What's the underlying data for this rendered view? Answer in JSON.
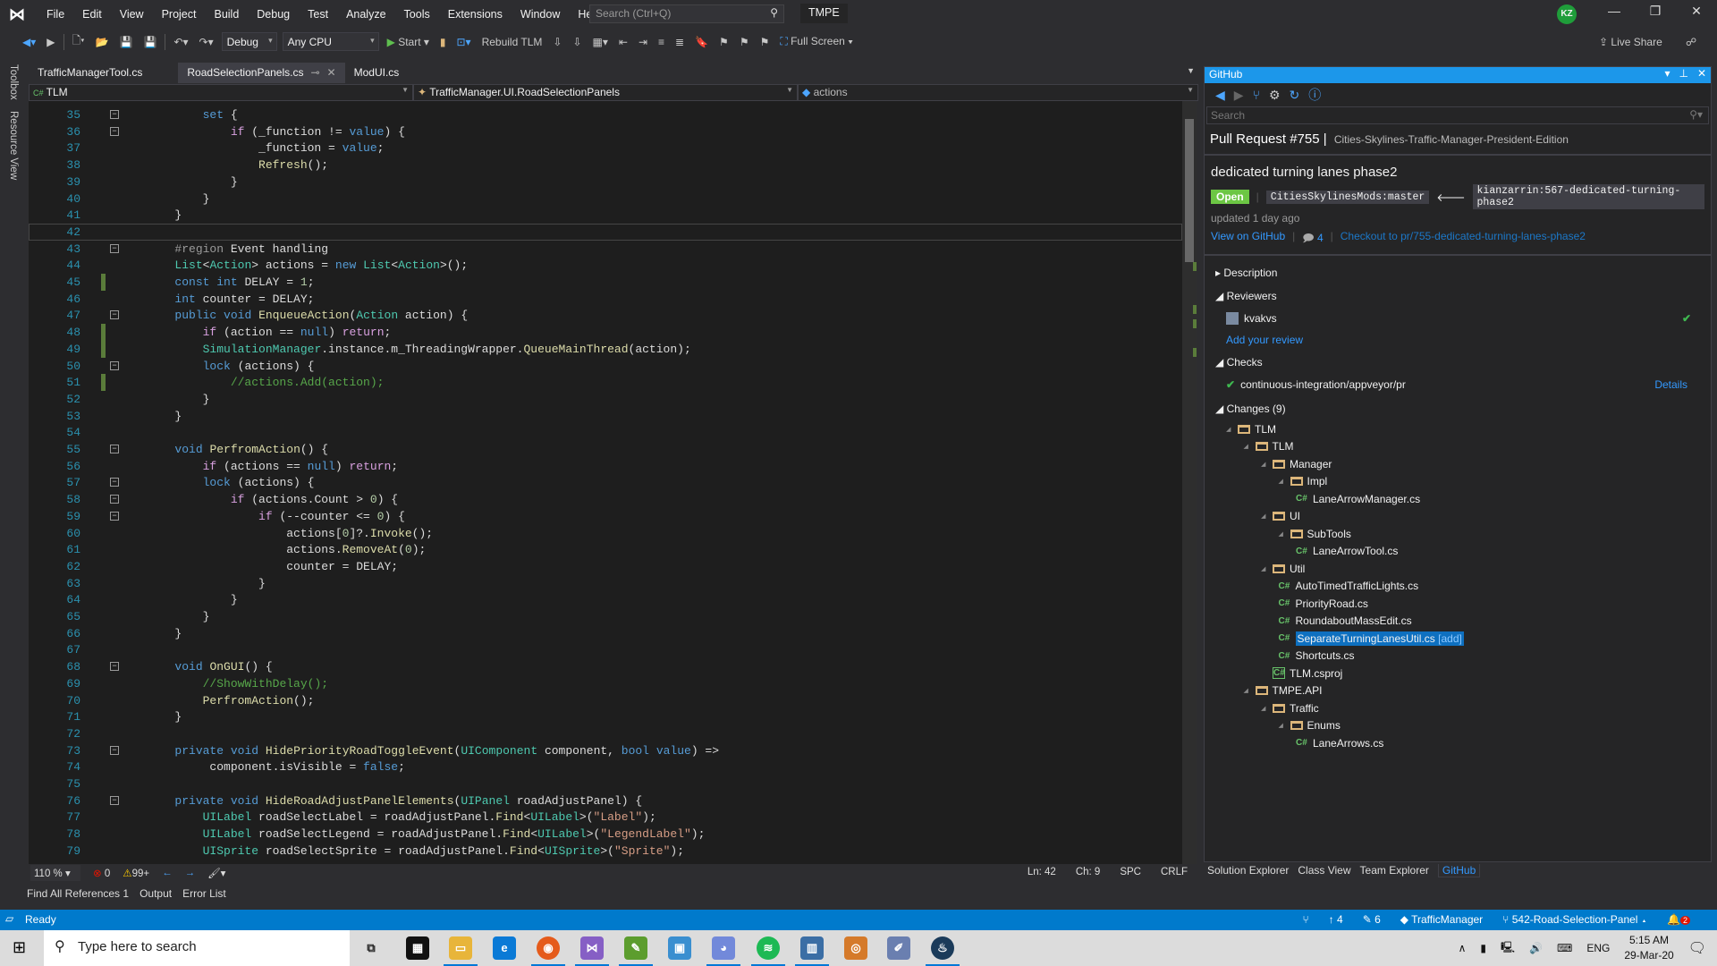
{
  "menubar": {
    "items": [
      "File",
      "Edit",
      "View",
      "Project",
      "Build",
      "Debug",
      "Test",
      "Analyze",
      "Tools",
      "Extensions",
      "Window",
      "Help"
    ],
    "search_placeholder": "Search (Ctrl+Q)",
    "solution": "TMPE",
    "user_initials": "KZ"
  },
  "toolbar": {
    "config": "Debug",
    "platform": "Any CPU",
    "start": "Start",
    "rebuild": "Rebuild TLM",
    "fullscreen": "Full Screen",
    "liveshare": "Live Share"
  },
  "left_strip": {
    "toolbox": "Toolbox",
    "resource_view": "Resource View"
  },
  "doc_tabs": [
    {
      "label": "TrafficManagerTool.cs",
      "active": false
    },
    {
      "label": "RoadSelectionPanels.cs",
      "active": true
    },
    {
      "label": "ModUI.cs",
      "active": false
    }
  ],
  "navbar": {
    "project": "TLM",
    "class": "TrafficManager.UI.RoadSelectionPanels",
    "member": "actions"
  },
  "editor": {
    "current_line": 42,
    "lines": [
      {
        "n": 35,
        "f": 1,
        "t": [
          [
            "p",
            "            "
          ],
          [
            "k",
            "set"
          ],
          [
            "p",
            " {"
          ]
        ]
      },
      {
        "n": 36,
        "f": 1,
        "t": [
          [
            "p",
            "                "
          ],
          [
            "c",
            "if"
          ],
          [
            "p",
            " (_function != "
          ],
          [
            "k",
            "value"
          ],
          [
            "p",
            ") {"
          ]
        ]
      },
      {
        "n": 37,
        "t": [
          [
            "p",
            "                    _function = "
          ],
          [
            "k",
            "value"
          ],
          [
            "p",
            ";"
          ]
        ]
      },
      {
        "n": 38,
        "t": [
          [
            "p",
            "                    "
          ],
          [
            "m",
            "Refresh"
          ],
          [
            "p",
            "();"
          ]
        ]
      },
      {
        "n": 39,
        "t": [
          [
            "p",
            "                }"
          ]
        ]
      },
      {
        "n": 40,
        "t": [
          [
            "p",
            "            }"
          ]
        ]
      },
      {
        "n": 41,
        "t": [
          [
            "p",
            "        }"
          ]
        ]
      },
      {
        "n": 42,
        "t": []
      },
      {
        "n": 43,
        "f": 1,
        "t": [
          [
            "p",
            "        "
          ],
          [
            "r",
            "#region"
          ],
          [
            "p",
            " Event handling"
          ]
        ]
      },
      {
        "n": 44,
        "t": [
          [
            "p",
            "        "
          ],
          [
            "t",
            "List"
          ],
          [
            "p",
            "<"
          ],
          [
            "t",
            "Action"
          ],
          [
            "p",
            "> actions = "
          ],
          [
            "k",
            "new"
          ],
          [
            "p",
            " "
          ],
          [
            "t",
            "List"
          ],
          [
            "p",
            "<"
          ],
          [
            "t",
            "Action"
          ],
          [
            "p",
            ">();"
          ]
        ]
      },
      {
        "n": 45,
        "g": 1,
        "t": [
          [
            "p",
            "        "
          ],
          [
            "k",
            "const"
          ],
          [
            "p",
            " "
          ],
          [
            "k",
            "int"
          ],
          [
            "p",
            " DELAY = "
          ],
          [
            "n",
            "1"
          ],
          [
            "p",
            ";"
          ]
        ]
      },
      {
        "n": 46,
        "t": [
          [
            "p",
            "        "
          ],
          [
            "k",
            "int"
          ],
          [
            "p",
            " counter = DELAY;"
          ]
        ]
      },
      {
        "n": 47,
        "f": 1,
        "t": [
          [
            "p",
            "        "
          ],
          [
            "k",
            "public"
          ],
          [
            "p",
            " "
          ],
          [
            "k",
            "void"
          ],
          [
            "p",
            " "
          ],
          [
            "m",
            "EnqueueAction"
          ],
          [
            "p",
            "("
          ],
          [
            "t",
            "Action"
          ],
          [
            "p",
            " action) {"
          ]
        ]
      },
      {
        "n": 48,
        "g": 1,
        "t": [
          [
            "p",
            "            "
          ],
          [
            "c",
            "if"
          ],
          [
            "p",
            " (action == "
          ],
          [
            "k",
            "null"
          ],
          [
            "p",
            ") "
          ],
          [
            "c",
            "return"
          ],
          [
            "p",
            ";"
          ]
        ]
      },
      {
        "n": 49,
        "g": 1,
        "t": [
          [
            "p",
            "            "
          ],
          [
            "t",
            "SimulationManager"
          ],
          [
            "p",
            ".instance.m_ThreadingWrapper."
          ],
          [
            "m",
            "QueueMainThread"
          ],
          [
            "p",
            "(action);"
          ]
        ]
      },
      {
        "n": 50,
        "f": 1,
        "t": [
          [
            "p",
            "            "
          ],
          [
            "k",
            "lock"
          ],
          [
            "p",
            " (actions) {"
          ]
        ]
      },
      {
        "n": 51,
        "g": 1,
        "t": [
          [
            "p",
            "                "
          ],
          [
            "cm",
            "//actions.Add(action);"
          ]
        ]
      },
      {
        "n": 52,
        "t": [
          [
            "p",
            "            }"
          ]
        ]
      },
      {
        "n": 53,
        "t": [
          [
            "p",
            "        }"
          ]
        ]
      },
      {
        "n": 54,
        "t": []
      },
      {
        "n": 55,
        "f": 1,
        "t": [
          [
            "p",
            "        "
          ],
          [
            "k",
            "void"
          ],
          [
            "p",
            " "
          ],
          [
            "m",
            "PerfromAction"
          ],
          [
            "p",
            "() {"
          ]
        ]
      },
      {
        "n": 56,
        "t": [
          [
            "p",
            "            "
          ],
          [
            "c",
            "if"
          ],
          [
            "p",
            " (actions == "
          ],
          [
            "k",
            "null"
          ],
          [
            "p",
            ") "
          ],
          [
            "c",
            "return"
          ],
          [
            "p",
            ";"
          ]
        ]
      },
      {
        "n": 57,
        "f": 1,
        "t": [
          [
            "p",
            "            "
          ],
          [
            "k",
            "lock"
          ],
          [
            "p",
            " (actions) {"
          ]
        ]
      },
      {
        "n": 58,
        "f": 1,
        "t": [
          [
            "p",
            "                "
          ],
          [
            "c",
            "if"
          ],
          [
            "p",
            " (actions.Count > "
          ],
          [
            "n",
            "0"
          ],
          [
            "p",
            ") {"
          ]
        ]
      },
      {
        "n": 59,
        "f": 1,
        "t": [
          [
            "p",
            "                    "
          ],
          [
            "c",
            "if"
          ],
          [
            "p",
            " (--counter <= "
          ],
          [
            "n",
            "0"
          ],
          [
            "p",
            ") {"
          ]
        ]
      },
      {
        "n": 60,
        "t": [
          [
            "p",
            "                        actions["
          ],
          [
            "n",
            "0"
          ],
          [
            "p",
            "]?."
          ],
          [
            "m",
            "Invoke"
          ],
          [
            "p",
            "();"
          ]
        ]
      },
      {
        "n": 61,
        "t": [
          [
            "p",
            "                        actions."
          ],
          [
            "m",
            "RemoveAt"
          ],
          [
            "p",
            "("
          ],
          [
            "n",
            "0"
          ],
          [
            "p",
            ");"
          ]
        ]
      },
      {
        "n": 62,
        "t": [
          [
            "p",
            "                        counter = DELAY;"
          ]
        ]
      },
      {
        "n": 63,
        "t": [
          [
            "p",
            "                    }"
          ]
        ]
      },
      {
        "n": 64,
        "t": [
          [
            "p",
            "                }"
          ]
        ]
      },
      {
        "n": 65,
        "t": [
          [
            "p",
            "            }"
          ]
        ]
      },
      {
        "n": 66,
        "t": [
          [
            "p",
            "        }"
          ]
        ]
      },
      {
        "n": 67,
        "t": []
      },
      {
        "n": 68,
        "f": 1,
        "t": [
          [
            "p",
            "        "
          ],
          [
            "k",
            "void"
          ],
          [
            "p",
            " "
          ],
          [
            "m",
            "OnGUI"
          ],
          [
            "p",
            "() {"
          ]
        ]
      },
      {
        "n": 69,
        "t": [
          [
            "p",
            "            "
          ],
          [
            "cm",
            "//ShowWithDelay();"
          ]
        ]
      },
      {
        "n": 70,
        "t": [
          [
            "p",
            "            "
          ],
          [
            "m",
            "PerfromAction"
          ],
          [
            "p",
            "();"
          ]
        ]
      },
      {
        "n": 71,
        "t": [
          [
            "p",
            "        }"
          ]
        ]
      },
      {
        "n": 72,
        "t": []
      },
      {
        "n": 73,
        "f": 1,
        "t": [
          [
            "p",
            "        "
          ],
          [
            "k",
            "private"
          ],
          [
            "p",
            " "
          ],
          [
            "k",
            "void"
          ],
          [
            "p",
            " "
          ],
          [
            "m",
            "HidePriorityRoadToggleEvent"
          ],
          [
            "p",
            "("
          ],
          [
            "t",
            "UIComponent"
          ],
          [
            "p",
            " component, "
          ],
          [
            "k",
            "bool"
          ],
          [
            "p",
            " "
          ],
          [
            "k",
            "value"
          ],
          [
            "p",
            ") =>"
          ]
        ]
      },
      {
        "n": 74,
        "t": [
          [
            "p",
            "             component.isVisible = "
          ],
          [
            "k",
            "false"
          ],
          [
            "p",
            ";"
          ]
        ]
      },
      {
        "n": 75,
        "t": []
      },
      {
        "n": 76,
        "f": 1,
        "t": [
          [
            "p",
            "        "
          ],
          [
            "k",
            "private"
          ],
          [
            "p",
            " "
          ],
          [
            "k",
            "void"
          ],
          [
            "p",
            " "
          ],
          [
            "m",
            "HideRoadAdjustPanelElements"
          ],
          [
            "p",
            "("
          ],
          [
            "t",
            "UIPanel"
          ],
          [
            "p",
            " roadAdjustPanel) {"
          ]
        ]
      },
      {
        "n": 77,
        "t": [
          [
            "p",
            "            "
          ],
          [
            "t",
            "UILabel"
          ],
          [
            "p",
            " roadSelectLabel = roadAdjustPanel."
          ],
          [
            "m",
            "Find"
          ],
          [
            "p",
            "<"
          ],
          [
            "t",
            "UILabel"
          ],
          [
            "p",
            ">("
          ],
          [
            "s",
            "\"Label\""
          ],
          [
            "p",
            ");"
          ]
        ]
      },
      {
        "n": 78,
        "t": [
          [
            "p",
            "            "
          ],
          [
            "t",
            "UILabel"
          ],
          [
            "p",
            " roadSelectLegend = roadAdjustPanel."
          ],
          [
            "m",
            "Find"
          ],
          [
            "p",
            "<"
          ],
          [
            "t",
            "UILabel"
          ],
          [
            "p",
            ">("
          ],
          [
            "s",
            "\"LegendLabel\""
          ],
          [
            "p",
            ");"
          ]
        ]
      },
      {
        "n": 79,
        "t": [
          [
            "p",
            "            "
          ],
          [
            "t",
            "UISprite"
          ],
          [
            "p",
            " roadSelectSprite = roadAdjustPanel."
          ],
          [
            "m",
            "Find"
          ],
          [
            "p",
            "<"
          ],
          [
            "t",
            "UISprite"
          ],
          [
            "p",
            ">("
          ],
          [
            "s",
            "\"Sprite\""
          ],
          [
            "p",
            ");"
          ]
        ]
      }
    ]
  },
  "editor_status": {
    "zoom": "110 %",
    "errors": "0",
    "warnings": "99+",
    "line": "Ln: 42",
    "col": "Ch: 9",
    "spacing": "SPC",
    "eol": "CRLF"
  },
  "bottom_tabs": [
    "Find All References 1",
    "Output",
    "Error List"
  ],
  "statusbar": {
    "ready": "Ready",
    "push": "4",
    "edits": "6",
    "repo": "TrafficManager",
    "branch": "542-Road-Selection-Panel",
    "notifications": "2"
  },
  "github": {
    "title": "GitHub",
    "search_placeholder": "Search",
    "pr_label": "Pull Request #755",
    "repo": "Cities-Skylines-Traffic-Manager-President-Edition",
    "pr_title": "dedicated turning lanes phase2",
    "state": "Open",
    "base": "CitiesSkylinesMods:master",
    "head": "kianzarrin:567-dedicated-turning-phase2",
    "updated": "updated 1 day ago",
    "view_link": "View on GitHub",
    "comments": "4",
    "checkout": "Checkout to pr/755-dedicated-turning-lanes-phase2",
    "description": "Description",
    "reviewers_label": "Reviewers",
    "reviewer": "kvakvs",
    "add_review": "Add your review",
    "checks_label": "Checks",
    "check": "continuous-integration/appveyor/pr",
    "details": "Details",
    "changes_label": "Changes (9)",
    "tree": [
      {
        "name": "TLM",
        "d": 0,
        "type": "folder"
      },
      {
        "name": "TLM",
        "d": 1,
        "type": "folder"
      },
      {
        "name": "Manager",
        "d": 2,
        "type": "folder"
      },
      {
        "name": "Impl",
        "d": 3,
        "type": "folder"
      },
      {
        "name": "LaneArrowManager.cs",
        "d": 4,
        "type": "cs"
      },
      {
        "name": "UI",
        "d": 2,
        "type": "folder"
      },
      {
        "name": "SubTools",
        "d": 3,
        "type": "folder"
      },
      {
        "name": "LaneArrowTool.cs",
        "d": 4,
        "type": "cs"
      },
      {
        "name": "Util",
        "d": 2,
        "type": "folder"
      },
      {
        "name": "AutoTimedTrafficLights.cs",
        "d": 3,
        "type": "cs"
      },
      {
        "name": "PriorityRoad.cs",
        "d": 3,
        "type": "cs"
      },
      {
        "name": "RoundaboutMassEdit.cs",
        "d": 3,
        "type": "cs"
      },
      {
        "name": "SeparateTurningLanesUtil.cs",
        "d": 3,
        "type": "cs",
        "selected": true,
        "tag": "[add]"
      },
      {
        "name": "Shortcuts.cs",
        "d": 3,
        "type": "cs"
      },
      {
        "name": "TLM.csproj",
        "d": 2,
        "type": "csproj"
      },
      {
        "name": "TMPE.API",
        "d": 1,
        "type": "folder"
      },
      {
        "name": "Traffic",
        "d": 2,
        "type": "folder"
      },
      {
        "name": "Enums",
        "d": 3,
        "type": "folder"
      },
      {
        "name": "LaneArrows.cs",
        "d": 4,
        "type": "cs"
      }
    ],
    "tabs": [
      "Solution Explorer",
      "Class View",
      "Team Explorer",
      "GitHub"
    ],
    "active_tab": "GitHub"
  },
  "taskbar": {
    "search_placeholder": "Type here to search",
    "language": "ENG",
    "time": "5:15 AM",
    "date": "29-Mar-20"
  },
  "colors": {
    "accent": "#007acc",
    "open_badge": "#6cc644",
    "selection": "#0e70c0"
  }
}
